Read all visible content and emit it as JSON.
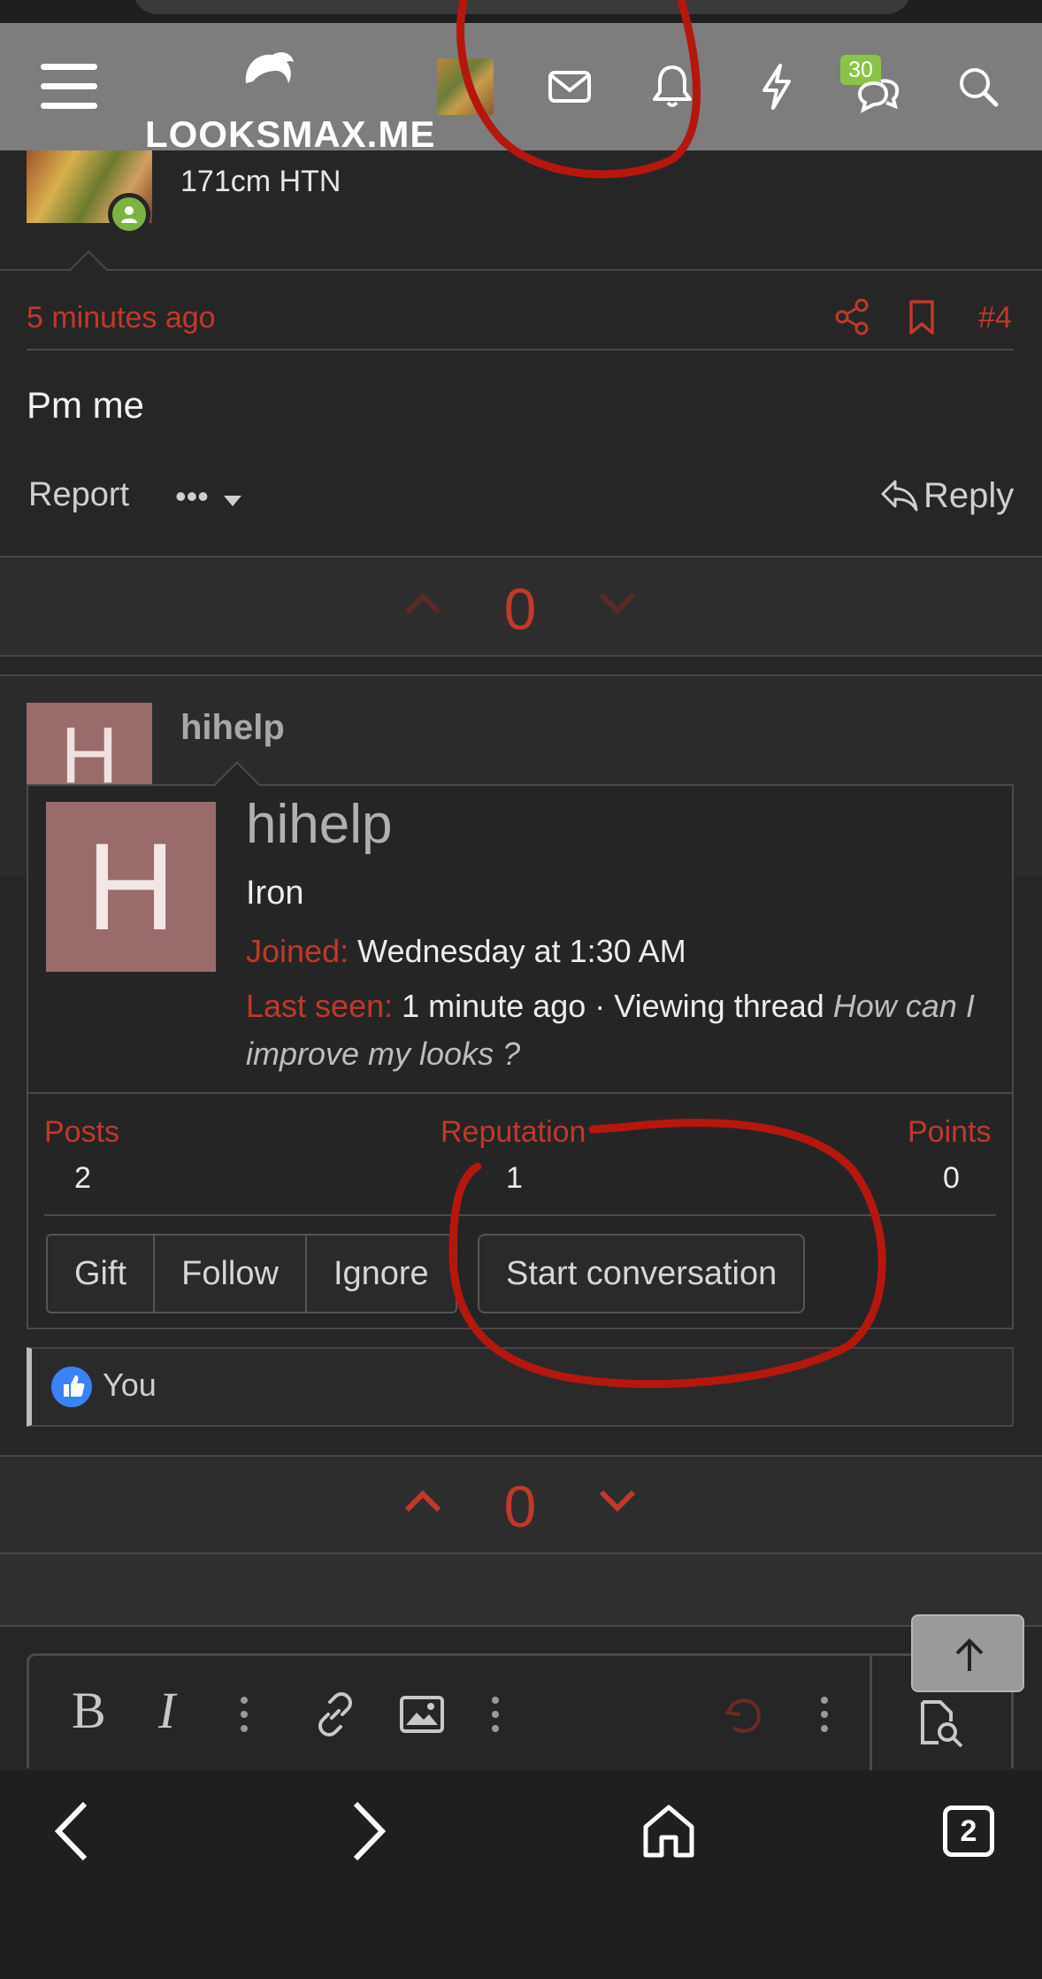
{
  "site": {
    "logo_text": "LOOKSMAX.ME"
  },
  "header": {
    "notifications_badge": "30"
  },
  "previous_post": {
    "user_title": "171cm HTN",
    "time": "5 minutes ago",
    "post_number": "#4",
    "body": "Pm me",
    "report_label": "Report",
    "more_label": "•••",
    "reply_label": "Reply",
    "score": "0"
  },
  "next_post": {
    "avatar_letter": "H",
    "username": "hihelp",
    "score": "0"
  },
  "member_card": {
    "avatar_letter": "H",
    "username": "hihelp",
    "rank": "Iron",
    "joined_label": "Joined:",
    "joined_value": "Wednesday at 1:30 AM",
    "last_seen_label": "Last seen:",
    "last_seen_value": "1 minute ago · Viewing thread ",
    "last_seen_thread": "How can I improve my looks ?",
    "stats": [
      {
        "label": "Posts",
        "value": "2"
      },
      {
        "label": "Reputation",
        "value": "1"
      },
      {
        "label": "Points",
        "value": "0"
      }
    ],
    "buttons": {
      "gift": "Gift",
      "follow": "Follow",
      "ignore": "Ignore",
      "start_conversation": "Start conversation"
    }
  },
  "reactions": {
    "text": "You"
  },
  "browser": {
    "tabs_count": "2"
  },
  "colors": {
    "accent": "#c0392b",
    "header_bg": "#7d7d7d",
    "page_bg": "#262626",
    "badge": "#8bc34a"
  }
}
